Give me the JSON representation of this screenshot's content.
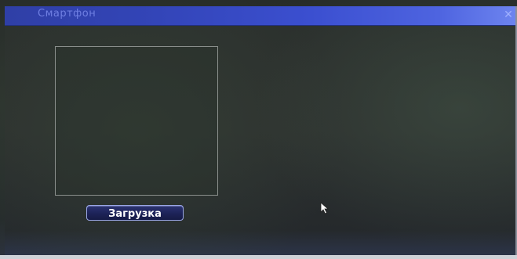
{
  "window": {
    "title": "Смартфон",
    "close_icon": "close-icon"
  },
  "preview": {
    "icon": "qr-code-placeholder"
  },
  "buttons": {
    "download_label": "Загрузка"
  },
  "pointer": {
    "icon": "mouse-cursor-icon"
  },
  "colors": {
    "titlebar": "#3345b8",
    "background": "#2b302d",
    "button": "#1d2358"
  }
}
